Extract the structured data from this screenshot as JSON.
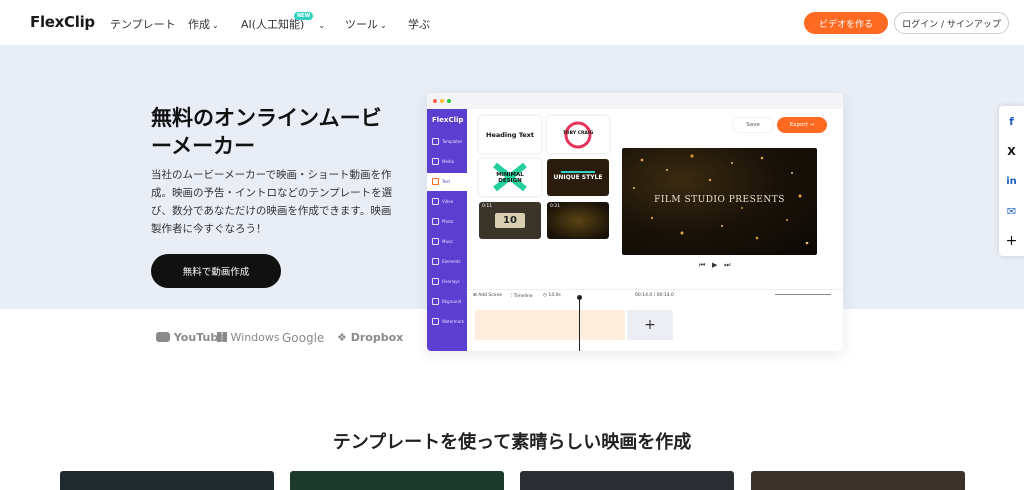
{
  "nav": {
    "logo": "FlexClip",
    "items": [
      {
        "label": "テンプレート",
        "has_chevron": false
      },
      {
        "label": "作成",
        "has_chevron": true
      },
      {
        "label": "AI(人工知能)",
        "has_chevron": true,
        "badge": "NEW"
      },
      {
        "label": "ツール",
        "has_chevron": true
      },
      {
        "label": "学ぶ",
        "has_chevron": false
      }
    ],
    "create_button": "ビデオを作る",
    "login_button": "ログイン / サインアップ"
  },
  "hero": {
    "title": "無料のオンラインムービーメーカー",
    "description": "当社のムービーメーカーで映画・ショート動画を作成。映画の予告・イントロなどのテンプレートを選び、数分であなただけの映画を作成できます。映画製作者に今すぐなろう！",
    "cta": "無料で動画作成"
  },
  "editor": {
    "logo": "FlexClip",
    "sidebar": [
      "Templates",
      "Media",
      "Text",
      "Video",
      "Photo",
      "Music",
      "Elements",
      "Overlays",
      "Bkground",
      "Watermark"
    ],
    "active_sidebar": "Text",
    "tiles": [
      {
        "label": "Heading Text"
      },
      {
        "label": "TOBY CRAIG"
      },
      {
        "label": "MINIMAL DESIGN"
      },
      {
        "label": "UNIQUE STYLE"
      },
      {
        "label": "10",
        "time": "0:11"
      },
      {
        "label": "",
        "time": "0:21"
      }
    ],
    "save": "Save",
    "export": "Export",
    "preview_title": "FILM STUDIO PRESENTS",
    "timeline": {
      "add_scene": "Add Scene",
      "timeline": "Timeline",
      "duration": "14.0s",
      "position": "00:14.0 / 00:14.0"
    },
    "add_symbol": "+"
  },
  "brands": [
    "YouTube",
    "Windows",
    "Google",
    "Dropbox"
  ],
  "social": [
    {
      "icon": "facebook-icon",
      "glyph": "f"
    },
    {
      "icon": "x-icon",
      "glyph": "X"
    },
    {
      "icon": "linkedin-icon",
      "glyph": "in"
    },
    {
      "icon": "email-icon",
      "glyph": "✉"
    },
    {
      "icon": "plus-icon",
      "glyph": "+"
    }
  ],
  "section": {
    "title": "テンプレートを使って素晴らしい映画を作成"
  },
  "colors": {
    "accent": "#ff6a22",
    "editor_sidebar": "#5b3fd1",
    "hero_bg": "#e8edf6"
  }
}
